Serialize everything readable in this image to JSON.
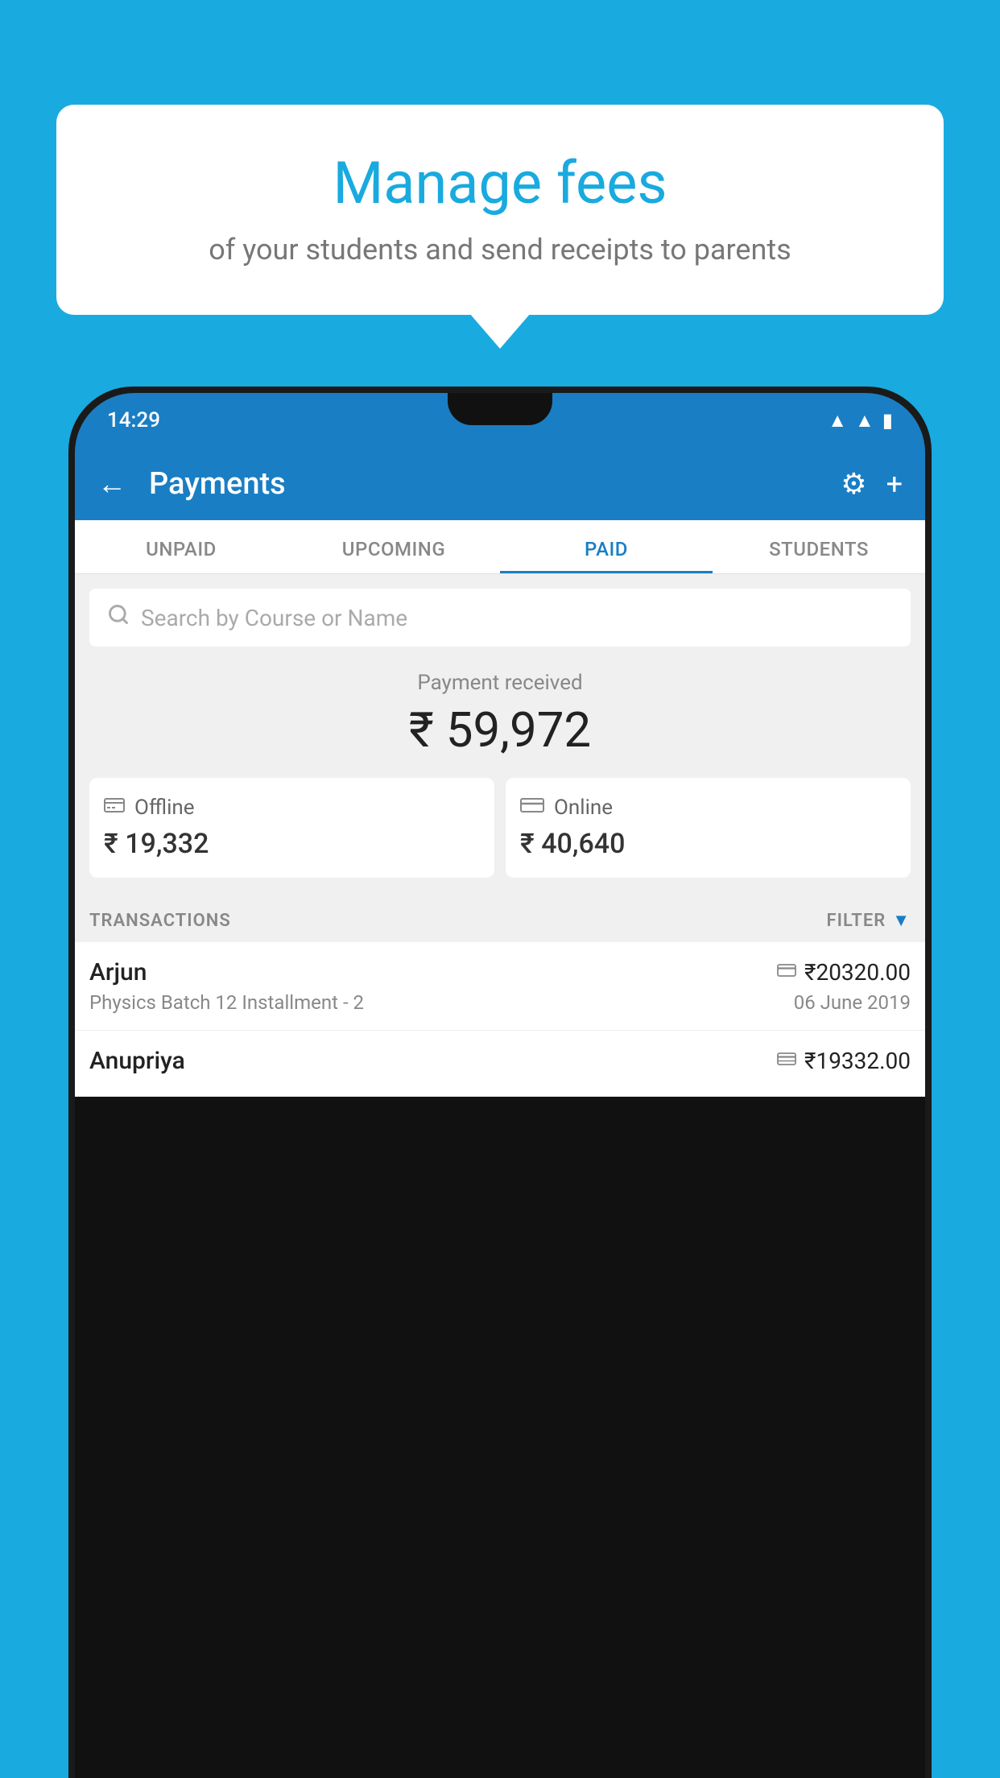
{
  "background_color": "#19AADF",
  "speech_bubble": {
    "title": "Manage fees",
    "subtitle": "of your students and send receipts to parents"
  },
  "phone": {
    "status_bar": {
      "time": "14:29",
      "wifi_icon": "▲",
      "signal_icon": "▲",
      "battery_icon": "▮"
    },
    "header": {
      "title": "Payments",
      "back_label": "←",
      "settings_label": "⚙",
      "add_label": "+"
    },
    "tabs": [
      {
        "label": "UNPAID",
        "active": false
      },
      {
        "label": "UPCOMING",
        "active": false
      },
      {
        "label": "PAID",
        "active": true
      },
      {
        "label": "STUDENTS",
        "active": false
      }
    ],
    "search": {
      "placeholder": "Search by Course or Name"
    },
    "payment_received": {
      "label": "Payment received",
      "amount": "₹ 59,972",
      "offline": {
        "type": "Offline",
        "amount": "₹ 19,332"
      },
      "online": {
        "type": "Online",
        "amount": "₹ 40,640"
      }
    },
    "transactions": {
      "header_label": "TRANSACTIONS",
      "filter_label": "FILTER",
      "items": [
        {
          "name": "Arjun",
          "course": "Physics Batch 12 Installment - 2",
          "amount": "₹20320.00",
          "date": "06 June 2019",
          "payment_type": "card"
        },
        {
          "name": "Anupriya",
          "course": "",
          "amount": "₹19332.00",
          "date": "",
          "payment_type": "cash"
        }
      ]
    }
  }
}
